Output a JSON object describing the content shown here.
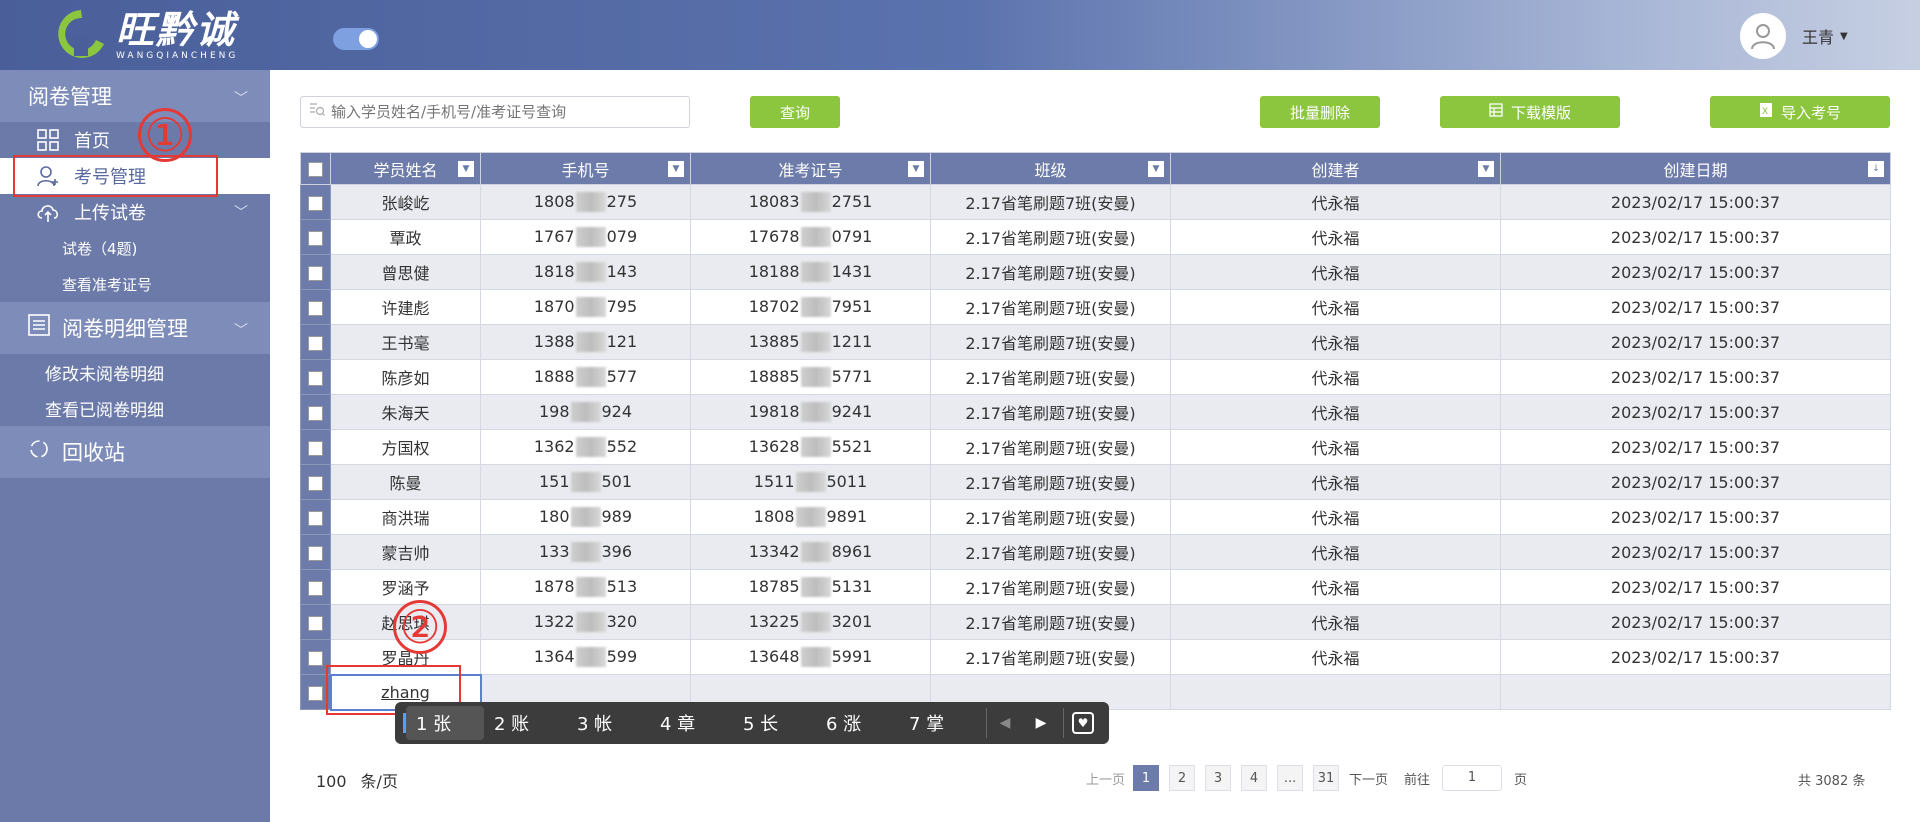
{
  "header": {
    "logo_cn": "旺黔诚",
    "logo_en": "WANGQIANCHENG",
    "user_name": "王青"
  },
  "sidebar": {
    "section1": "阅卷管理",
    "items": [
      {
        "label": "首页",
        "icon": "grid-icon"
      },
      {
        "label": "考号管理",
        "icon": "user-add-icon",
        "active": true
      },
      {
        "label": "上传试卷",
        "icon": "cloud-upload-icon"
      }
    ],
    "subitems": [
      "试卷（4题)",
      "查看准考证号"
    ],
    "section2": "阅卷明细管理",
    "section2_items": [
      "修改未阅卷明细",
      "查看已阅卷明细"
    ],
    "section3": "回收站"
  },
  "toolbar": {
    "search_placeholder": "输入学员姓名/手机号/准考证号查询",
    "query_label": "查询",
    "batch_delete_label": "批量删除",
    "download_template_label": "下载模版",
    "import_label": "导入考号"
  },
  "table": {
    "columns": [
      "学员姓名",
      "手机号",
      "准考证号",
      "班级",
      "创建者",
      "创建日期"
    ],
    "rows": [
      {
        "name": "张峻屹",
        "phone_a": "1808",
        "phone_b": "275",
        "ticket_a": "18083",
        "ticket_b": "2751"
      },
      {
        "name": "覃政",
        "phone_a": "1767",
        "phone_b": "079",
        "ticket_a": "17678",
        "ticket_b": "0791"
      },
      {
        "name": "曾思健",
        "phone_a": "1818",
        "phone_b": "143",
        "ticket_a": "18188",
        "ticket_b": "1431"
      },
      {
        "name": "许建彪",
        "phone_a": "1870",
        "phone_b": "795",
        "ticket_a": "18702",
        "ticket_b": "7951"
      },
      {
        "name": "王书毫",
        "phone_a": "1388",
        "phone_b": "121",
        "ticket_a": "13885",
        "ticket_b": "1211"
      },
      {
        "name": "陈彦如",
        "phone_a": "1888",
        "phone_b": "577",
        "ticket_a": "18885",
        "ticket_b": "5771"
      },
      {
        "name": "朱海天",
        "phone_a": "198",
        "phone_b": "924",
        "ticket_a": "19818",
        "ticket_b": "9241"
      },
      {
        "name": "方国权",
        "phone_a": "1362",
        "phone_b": "552",
        "ticket_a": "13628",
        "ticket_b": "5521"
      },
      {
        "name": "陈曼",
        "phone_a": "151",
        "phone_b": "501",
        "ticket_a": "1511",
        "ticket_b": "5011"
      },
      {
        "name": "商洪瑞",
        "phone_a": "180",
        "phone_b": "989",
        "ticket_a": "1808",
        "ticket_b": "9891"
      },
      {
        "name": "蒙吉帅",
        "phone_a": "133",
        "phone_b": "396",
        "ticket_a": "13342",
        "ticket_b": "8961"
      },
      {
        "name": "罗涵予",
        "phone_a": "1878",
        "phone_b": "513",
        "ticket_a": "18785",
        "ticket_b": "5131"
      },
      {
        "name": "赵思琪",
        "phone_a": "1322",
        "phone_b": "320",
        "ticket_a": "13225",
        "ticket_b": "3201"
      },
      {
        "name": "罗晶丹",
        "phone_a": "1364",
        "phone_b": "599",
        "ticket_a": "13648",
        "ticket_b": "5991"
      }
    ],
    "class_value": "2.17省笔刷题7班(安曼)",
    "creator_value": "代永福",
    "date_value": "2023/02/17 15:00:37",
    "editing_value": "zhang"
  },
  "annotations": {
    "one": "①",
    "two": "②"
  },
  "ime": {
    "candidates": [
      "1 张",
      "2 账",
      "3 帐",
      "4 章",
      "5 长",
      "6 涨",
      "7 掌"
    ]
  },
  "pagination": {
    "page_size": "100",
    "page_size_unit": "条/页",
    "prev": "上一页",
    "pages": [
      "1",
      "2",
      "3",
      "4",
      "...",
      "31"
    ],
    "next": "下一页",
    "goto_label": "前往",
    "goto_value": "1",
    "goto_unit": "页",
    "total": "共 3082 条"
  },
  "colors": {
    "accent": "#6c7ba9",
    "button_green": "#8cc63f",
    "annotation_red": "#e53935"
  }
}
